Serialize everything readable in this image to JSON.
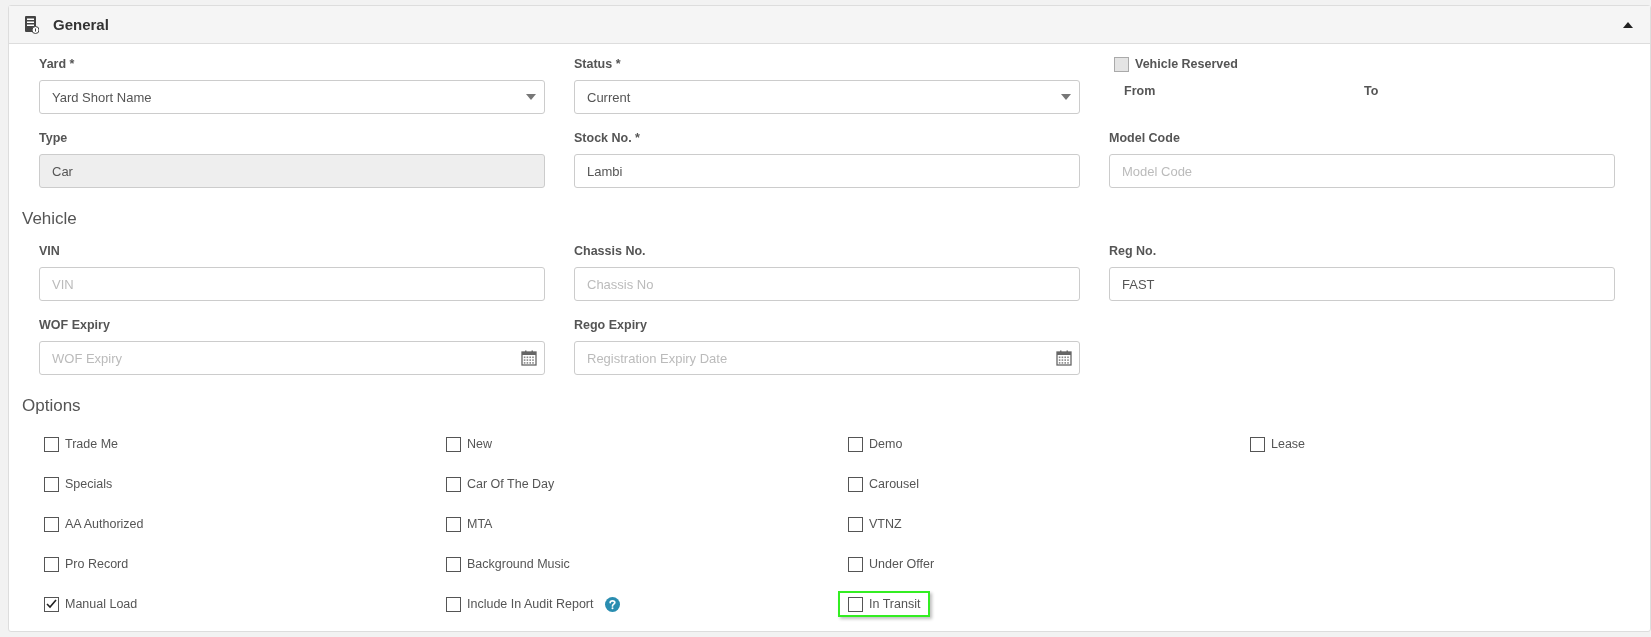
{
  "panel": {
    "title": "General",
    "expanded": true
  },
  "general_rows": [
    [
      {
        "kind": "select",
        "label": "Yard *",
        "value": "Yard Short Name"
      },
      {
        "kind": "select",
        "label": "Status *",
        "value": "Current"
      },
      {
        "kind": "reserved",
        "label": "Vehicle Reserved",
        "checked": false,
        "from": "From",
        "to": "To"
      }
    ],
    [
      {
        "kind": "text",
        "label": "Type",
        "value": "Car",
        "disabled": true
      },
      {
        "kind": "text",
        "label": "Stock No. *",
        "value": "Lambi",
        "disabled": false
      },
      {
        "kind": "text",
        "label": "Model Code",
        "placeholder": "Model Code",
        "disabled": false
      }
    ]
  ],
  "vehicle": {
    "heading": "Vehicle",
    "rows": [
      [
        {
          "kind": "text",
          "label": "VIN",
          "placeholder": "VIN",
          "disabled": false
        },
        {
          "kind": "text",
          "label": "Chassis No.",
          "placeholder": "Chassis No",
          "disabled": false
        },
        {
          "kind": "text",
          "label": "Reg No.",
          "value": "FAST",
          "disabled": false
        }
      ],
      [
        {
          "kind": "date",
          "label": "WOF Expiry",
          "placeholder": "WOF Expiry"
        },
        {
          "kind": "date",
          "label": "Rego Expiry",
          "placeholder": "Registration Expiry Date"
        }
      ]
    ]
  },
  "options": {
    "heading": "Options",
    "columns": [
      [
        {
          "label": "Trade Me",
          "checked": false
        },
        {
          "label": "Specials",
          "checked": false
        },
        {
          "label": "AA Authorized",
          "checked": false
        },
        {
          "label": "Pro Record",
          "checked": false
        },
        {
          "label": "Manual Load",
          "checked": true
        }
      ],
      [
        {
          "label": "New",
          "checked": false
        },
        {
          "label": "Car Of The Day",
          "checked": false
        },
        {
          "label": "MTA",
          "checked": false
        },
        {
          "label": "Background Music",
          "checked": false
        },
        {
          "label": "Include In Audit Report",
          "checked": false,
          "help": true
        }
      ],
      [
        {
          "label": "Demo",
          "checked": false
        },
        {
          "label": "Carousel",
          "checked": false
        },
        {
          "label": "VTNZ",
          "checked": false
        },
        {
          "label": "Under Offer",
          "checked": false
        },
        {
          "label": "In Transit",
          "checked": false,
          "highlighted": true
        }
      ],
      [
        {
          "label": "Lease",
          "checked": false
        }
      ]
    ]
  }
}
